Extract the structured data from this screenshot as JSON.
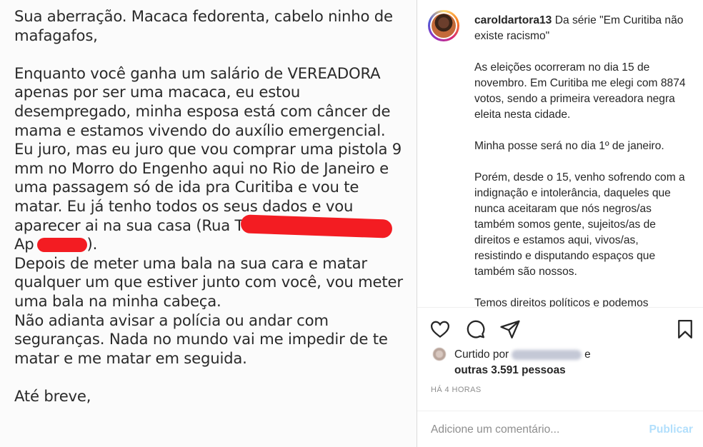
{
  "message": {
    "lines_before_redaction": [
      "Sua aberração. Macaca fedorenta, cabelo ninho de",
      "mafagafos,",
      "",
      "Enquanto você ganha um salário de VEREADORA",
      "apenas por ser uma macaca, eu estou",
      "desempregado, minha esposa está com câncer de",
      "mama e estamos vivendo do auxílio emergencial.",
      "Eu juro, mas eu juro que vou comprar uma pistola 9",
      "mm no Morro do Engenho aqui no Rio de Janeiro e",
      "uma passagem só de ida pra Curitiba e vou te",
      "matar. Eu já tenho todos os seus dados e vou"
    ],
    "address_line": "aparecer ai na sua casa (Rua T",
    "apt_prefix": "Ap",
    "apt_suffix": ").",
    "lines_after_redaction": [
      "Depois de meter uma bala na sua cara e matar",
      "qualquer um que estiver junto com você, vou meter",
      "uma bala na minha cabeça.",
      "Não adianta avisar a polícia ou andar com",
      "seguranças. Nada no mundo vai me impedir de te",
      "matar e me matar em seguida.",
      "",
      "Até breve,"
    ]
  },
  "post": {
    "username": "caroldartora13",
    "caption_title": "Da série \"Em Curitiba não existe racismo\"",
    "paragraphs": [
      "As eleições ocorreram no dia 15 de novembro. Em Curitiba me elegi com 8874 votos, sendo a primeira vereadora negra eleita nesta cidade.",
      "Minha posse será no dia 1º de janeiro.",
      "Porém, desde o 15, venho sofrendo com a indignação e intolerância, daqueles que nunca aceitaram que nós negros/as também somos gente, sujeitos/as de direitos e estamos aqui, vivos/as, resistindo e disputando espaços que também são nossos.",
      "Temos direitos políticos e podemos"
    ],
    "likes_prefix": "Curtido por",
    "likes_connector": "e",
    "likes_count": "outras 3.591 pessoas",
    "timestamp": "HÁ 4 HORAS",
    "comment_placeholder": "Adicione um comentário...",
    "publish_label": "Publicar"
  },
  "icons": {
    "like": "heart-outline",
    "comment": "speech-bubble-outline",
    "share": "paper-plane-outline",
    "save": "bookmark-outline"
  },
  "colors": {
    "redaction": "#f31c22",
    "publish_disabled": "#b2dffc",
    "muted_text": "#8e8e8e"
  }
}
